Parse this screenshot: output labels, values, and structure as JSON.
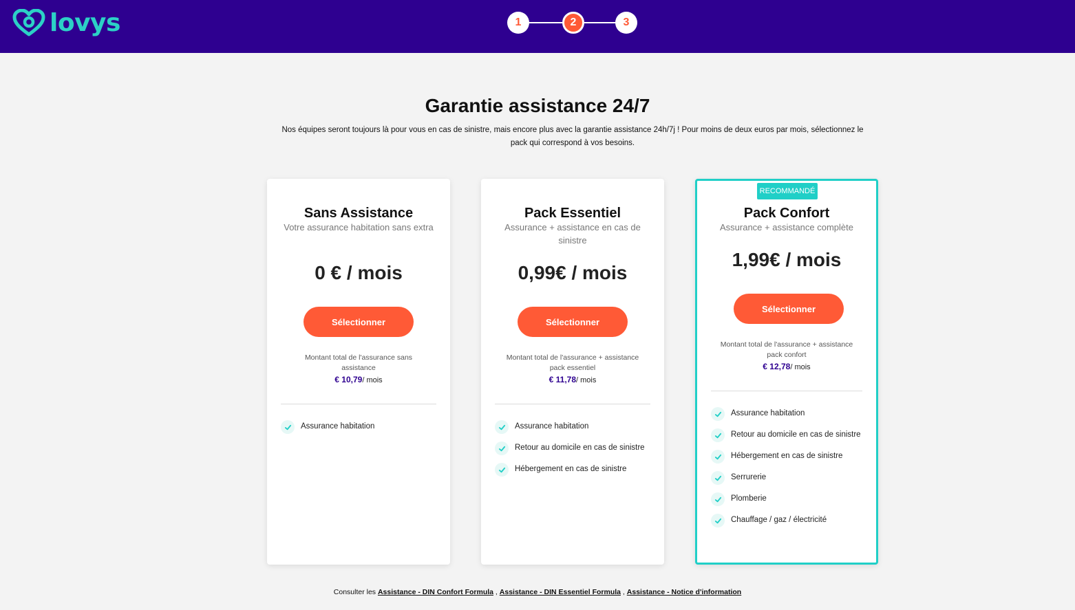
{
  "header": {
    "logo_text": "lovys",
    "steps": [
      "1",
      "2",
      "3"
    ],
    "active_step": 2
  },
  "intro": {
    "title": "Garantie assistance 24/7",
    "subtitle": "Nos équipes seront toujours là pour vous en cas de sinistre, mais encore plus avec la garantie assistance 24h/7j ! Pour moins de deux euros par mois, sélectionnez le pack qui correspond à vos besoins."
  },
  "plans": [
    {
      "name": "Sans Assistance",
      "description": "Votre assurance habitation sans extra",
      "price": "0 € / mois",
      "button": "Sélectionner",
      "total_label": "Montant total de l'assurance sans assistance",
      "total_amount": "€ 10,79",
      "total_unit": "/ mois",
      "features": [
        "Assurance habitation"
      ]
    },
    {
      "name": "Pack Essentiel",
      "description": "Assurance + assistance en cas de sinistre",
      "price": "0,99€ / mois",
      "button": "Sélectionner",
      "total_label": "Montant total de l'assurance + assistance pack essentiel",
      "total_amount": "€ 11,78",
      "total_unit": "/ mois",
      "features": [
        "Assurance habitation",
        "Retour au domicile en cas de sinistre",
        "Hébergement en cas de sinistre"
      ]
    },
    {
      "badge": "RECOMMANDÉ",
      "name": "Pack Confort",
      "description": "Assurance + assistance complète",
      "price": "1,99€ / mois",
      "button": "Sélectionner",
      "total_label": "Montant total de l'assurance + assistance pack confort",
      "total_amount": "€ 12,78",
      "total_unit": "/ mois",
      "features": [
        "Assurance habitation",
        "Retour au domicile en cas de sinistre",
        "Hébergement en cas de sinistre",
        "Serrurerie",
        "Plomberie",
        "Chauffage / gaz / électricité"
      ]
    }
  ],
  "footer": {
    "prefix": "Consulter les",
    "link1": "Assistance - DIN Confort Formula",
    "sep1": ",",
    "link2": "Assistance - DIN Essentiel Formula",
    "sep2": ",",
    "link3": "Assistance - Notice d'information"
  },
  "colors": {
    "header_bg": "#2e0090",
    "accent": "#ff5a36",
    "teal": "#20cfc7"
  }
}
